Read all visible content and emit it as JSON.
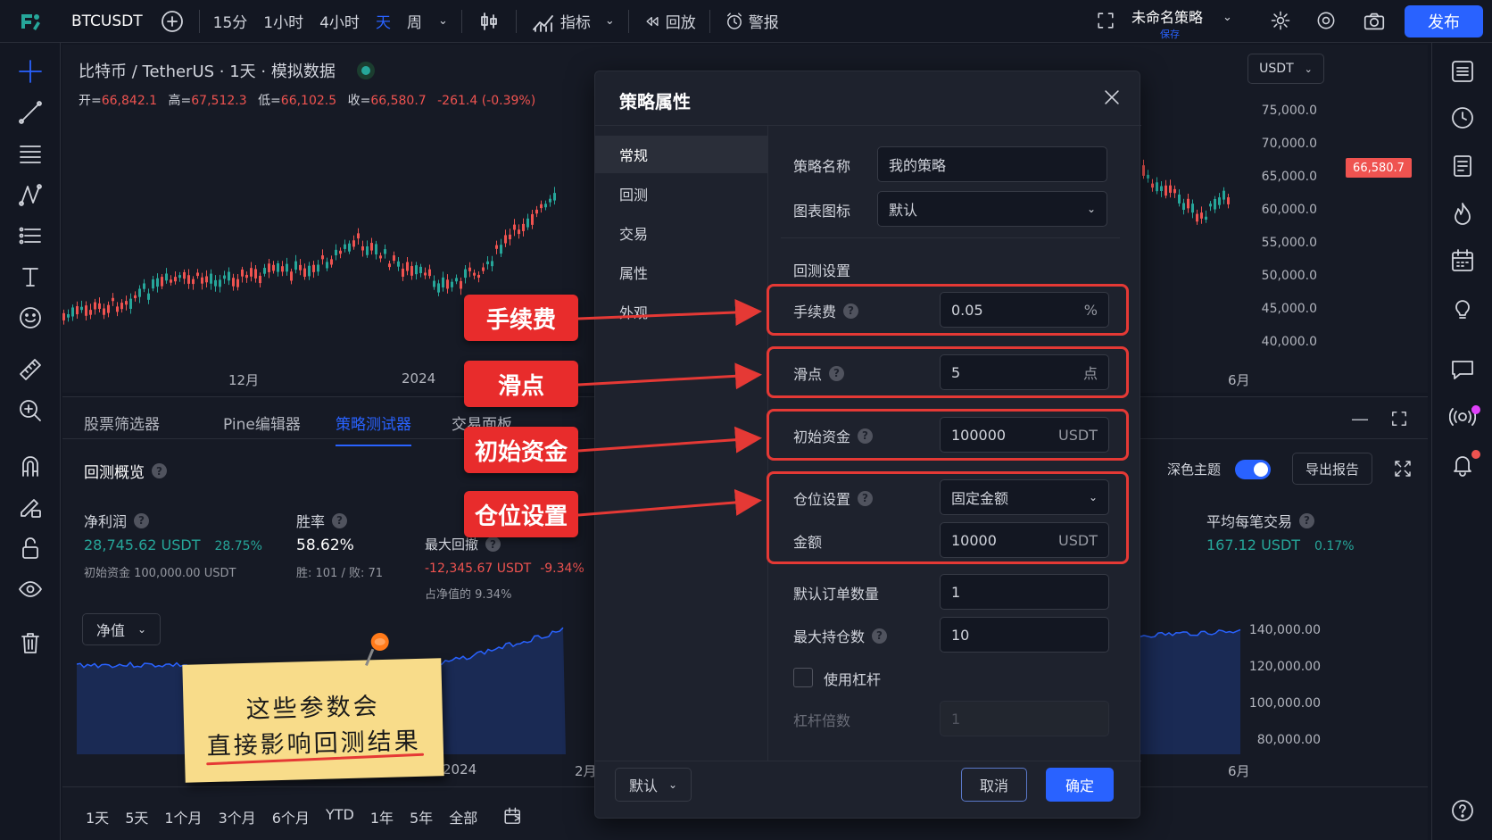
{
  "topbar": {
    "symbol": "BTCUSDT",
    "intervals": [
      "15分",
      "1小时",
      "4小时",
      "天",
      "周"
    ],
    "active_interval": "天",
    "indicators": "指标",
    "replay": "回放",
    "alert": "警报",
    "strategy_name": "未命名策略",
    "strategy_status": "保存",
    "publish": "发布"
  },
  "chart": {
    "title": "比特币 / TetherUS · 1天 · 模拟数据",
    "ohlc": [
      {
        "label": "开=",
        "value": "66,842.1"
      },
      {
        "label": "高=",
        "value": "67,512.3"
      },
      {
        "label": "低=",
        "value": "66,102.5"
      },
      {
        "label": "收=",
        "value": "66,580.7"
      }
    ],
    "change": "-261.4 (-0.39%)",
    "currency": "USDT",
    "price_ticks": [
      "75,000.0",
      "70,000.0",
      "65,000.0",
      "60,000.0",
      "55,000.0",
      "50,000.0",
      "45,000.0",
      "40,000.0"
    ],
    "last_price": "66,580.7",
    "time_labels": [
      "12月",
      "2024",
      "6月"
    ],
    "colors": {
      "up": "#26a69a",
      "down": "#ef5350",
      "accent": "#2962ff"
    }
  },
  "bottom": {
    "tabs": [
      "股票筛选器",
      "Pine编辑器",
      "策略测试器",
      "交易面板"
    ],
    "active_tab": "策略测试器",
    "overview": "回测概览",
    "dark_theme": "深色主题",
    "export": "导出报告",
    "net_profit": {
      "label": "净利润",
      "value": "28,745.62 USDT",
      "pct": "28.75%",
      "sub": "初始资金 100,000.00 USDT"
    },
    "win_rate": {
      "label": "胜率",
      "value": "58.62%",
      "sub": "胜: 101 / 败: 71"
    },
    "max_dd": {
      "label": "最大回撤",
      "value": "-12,345.67 USDT",
      "pct": "-9.34%",
      "sub": "占净值的 9.34%"
    },
    "avg_trade": {
      "label": "平均每笔交易",
      "value": "167.12 USDT",
      "pct": "0.17%"
    },
    "equity_select": "净值",
    "equity_ticks": [
      "140,000.00",
      "120,000.00",
      "100,000.00",
      "80,000.00"
    ],
    "equity_time_labels": [
      "2024",
      "2月",
      "6月"
    ],
    "ranges": [
      "1天",
      "5天",
      "1个月",
      "3个月",
      "6个月",
      "YTD",
      "1年",
      "5年",
      "全部"
    ]
  },
  "dialog": {
    "title": "策略属性",
    "sidebar": [
      "常规",
      "回测",
      "交易",
      "属性",
      "外观"
    ],
    "active_sidebar": "常规",
    "strategy_name_label": "策略名称",
    "strategy_name_value": "我的策略",
    "chart_icon_label": "图表图标",
    "chart_icon_value": "默认",
    "backtest_section": "回测设置",
    "fee_label": "手续费",
    "fee_value": "0.05",
    "fee_unit": "%",
    "slippage_label": "滑点",
    "slippage_value": "5",
    "slippage_unit": "点",
    "capital_label": "初始资金",
    "capital_value": "100000",
    "capital_unit": "USDT",
    "position_label": "仓位设置",
    "position_value": "固定金额",
    "amount_label": "金额",
    "amount_value": "10000",
    "amount_unit": "USDT",
    "order_qty_label": "默认订单数量",
    "order_qty_value": "1",
    "max_pos_label": "最大持仓数",
    "max_pos_value": "10",
    "leverage_label": "使用杠杆",
    "leverage_mult_label": "杠杆倍数",
    "leverage_mult_value": "1",
    "defaults_button": "默认",
    "cancel_button": "取消",
    "ok_button": "确定"
  },
  "annotations": {
    "fee": "手续费",
    "slippage": "滑点",
    "capital": "初始资金",
    "position": "仓位设置",
    "note_line1": "这些参数会",
    "note_line2": "直接影响回测结果",
    "highlight_color": "#e53935"
  }
}
